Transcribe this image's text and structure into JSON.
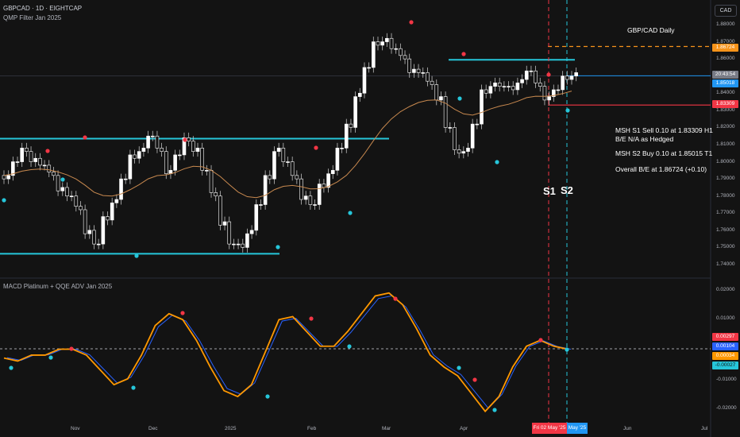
{
  "header": {
    "symbol_line": "GBPCAD · 1D · EIGHTCAP",
    "indicator_line": "QMP Filter Jan 2025",
    "currency_button": "CAD"
  },
  "price_axis": {
    "ticks": [
      "1.88000",
      "1.87000",
      "1.86000",
      "1.85000",
      "1.84000",
      "1.83000",
      "1.82000",
      "1.81000",
      "1.80000",
      "1.79000",
      "1.78000",
      "1.77000",
      "1.76000",
      "1.75000",
      "1.74000"
    ],
    "tags": {
      "be_level": {
        "text": "1.86724",
        "color": "#f7931a"
      },
      "countdown": {
        "text": "20:43:54",
        "color": "#787b86"
      },
      "last_price": {
        "text": "1.85018",
        "color": "#2196f3"
      },
      "sell_level": {
        "text": "1.83309",
        "color": "#f23645"
      }
    }
  },
  "annotations": {
    "title": "GBP/CAD Daily",
    "line1": "MSH S1 Sell 0.10 at 1.83309 H1",
    "line2": "B/E N/A as Hedged",
    "line3": "MSH S2 Buy 0.10 at 1.85015 T1",
    "line4": "Overall B/E at 1.86724 (+0.10)",
    "s1": "S1",
    "s2": "S2"
  },
  "macd_panel": {
    "label": "MACD Platinum + QQE ADV Jan 2025",
    "ticks": [
      "0.02000",
      "0.01000",
      "-0.01000",
      "-0.02000"
    ],
    "tags": [
      {
        "text": "0.00297",
        "color": "#f23645"
      },
      {
        "text": "0.00104",
        "color": "#2962ff"
      },
      {
        "text": "0.00034",
        "color": "#ff9800"
      },
      {
        "text": "-0.00027",
        "color": "#26c6da"
      }
    ]
  },
  "time_axis": {
    "labels": [
      "Nov",
      "Dec",
      "2025",
      "Feb",
      "Mar",
      "Apr",
      "Jun",
      "Jul"
    ],
    "highlight_s1": "Fri 02 May '25",
    "highlight_s2": "May '25"
  },
  "colors": {
    "background": "#131313",
    "bull_candle": "#ffffff",
    "bear_candle": "#ffffff",
    "level_line": "#26c6da",
    "moving_average": "#c8894f",
    "be_line": "#f7931a",
    "sell_line": "#f23645",
    "buy_line": "#2196f3"
  },
  "chart_data": {
    "type": "candlestick",
    "symbol": "GBPCAD",
    "timeframe": "1D",
    "horizontal_levels": {
      "range_top": 1.8135,
      "range_bottom": 1.7463,
      "resistance": 1.8595,
      "break_even": 1.86724,
      "s1_sell": 1.83309,
      "s2_buy": 1.85015,
      "last": 1.85018
    },
    "price_path_approx": [
      1.792,
      1.8,
      1.806,
      1.802,
      1.798,
      1.792,
      1.785,
      1.78,
      1.772,
      1.76,
      1.752,
      1.766,
      1.778,
      1.79,
      1.802,
      1.808,
      1.815,
      1.806,
      1.795,
      1.804,
      1.812,
      1.808,
      1.795,
      1.78,
      1.765,
      1.752,
      1.75,
      1.76,
      1.775,
      1.79,
      1.808,
      1.8,
      1.79,
      1.78,
      1.775,
      1.785,
      1.795,
      1.808,
      1.82,
      1.84,
      1.855,
      1.868,
      1.872,
      1.866,
      1.86,
      1.854,
      1.852,
      1.845,
      1.838,
      1.82,
      1.805,
      1.808,
      1.822,
      1.84,
      1.846,
      1.844,
      1.842,
      1.848,
      1.853,
      1.844,
      1.838,
      1.842,
      1.848,
      1.852
    ],
    "macd_path_approx": [
      -0.003,
      -0.004,
      -0.002,
      -0.002,
      0.0,
      0.0,
      -0.002,
      -0.007,
      -0.012,
      -0.01,
      -0.002,
      0.008,
      0.012,
      0.01,
      0.003,
      -0.006,
      -0.014,
      -0.016,
      -0.012,
      -0.001,
      0.01,
      0.011,
      0.006,
      0.001,
      0.001,
      0.006,
      0.012,
      0.018,
      0.019,
      0.015,
      0.007,
      -0.002,
      -0.006,
      -0.009,
      -0.015,
      -0.021,
      -0.016,
      -0.006,
      0.001,
      0.003,
      0.001,
      0.0
    ]
  }
}
